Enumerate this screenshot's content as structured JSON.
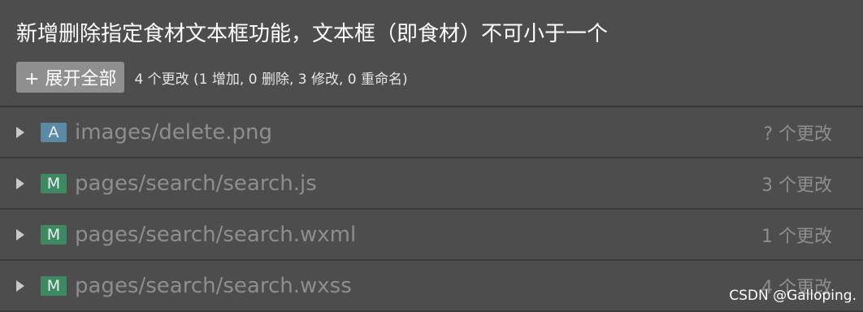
{
  "commit": {
    "title": "新增删除指定食材文本框功能，文本框（即食材）不可小于一个",
    "expand_all_label": "+ 展开全部",
    "summary": "4 个更改 (1 增加, 0 删除, 3 修改, 0 重命名)"
  },
  "files": [
    {
      "status": "A",
      "status_color": "#5b89a6",
      "name": "images/delete.png",
      "changes": "? 个更改"
    },
    {
      "status": "M",
      "status_color": "#3d8a62",
      "name": "pages/search/search.js",
      "changes": "3 个更改"
    },
    {
      "status": "M",
      "status_color": "#3d8a62",
      "name": "pages/search/search.wxml",
      "changes": "1 个更改"
    },
    {
      "status": "M",
      "status_color": "#3d8a62",
      "name": "pages/search/search.wxss",
      "changes": "4 个更改"
    }
  ],
  "watermark": "CSDN @Galloping."
}
